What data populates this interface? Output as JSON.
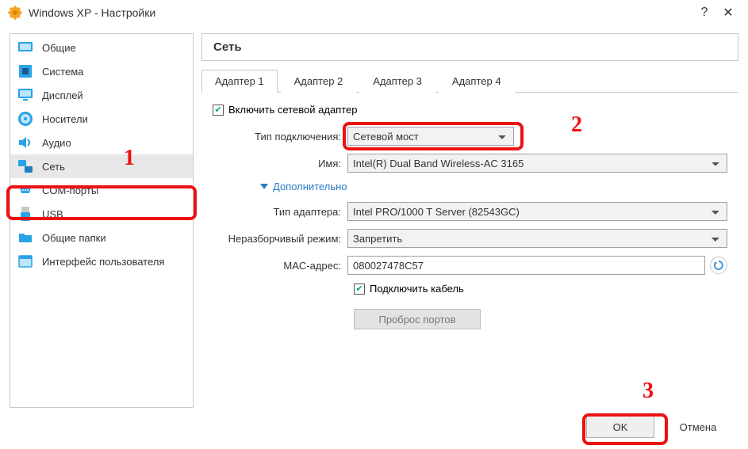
{
  "titlebar": {
    "title": "Windows XP - Настройки"
  },
  "sidebar": {
    "items": [
      {
        "label": "Общие"
      },
      {
        "label": "Система"
      },
      {
        "label": "Дисплей"
      },
      {
        "label": "Носители"
      },
      {
        "label": "Аудио"
      },
      {
        "label": "Сеть"
      },
      {
        "label": "COM-порты"
      },
      {
        "label": "USB"
      },
      {
        "label": "Общие папки"
      },
      {
        "label": "Интерфейс пользователя"
      }
    ],
    "selected_index": 5
  },
  "main": {
    "heading": "Сеть",
    "tabs": [
      {
        "label": "Адаптер 1"
      },
      {
        "label": "Адаптер 2"
      },
      {
        "label": "Адаптер 3"
      },
      {
        "label": "Адаптер 4"
      }
    ],
    "active_tab": 0,
    "enable_adapter": {
      "label": "Включить сетевой адаптер",
      "checked": true
    },
    "conn_type": {
      "label": "Тип подключения:",
      "value": "Сетевой мост"
    },
    "name": {
      "label": "Имя:",
      "value": "Intel(R) Dual Band Wireless-AC 3165"
    },
    "advanced": {
      "label": "Дополнительно"
    },
    "adapter_type": {
      "label": "Тип адаптера:",
      "value": "Intel PRO/1000 T Server (82543GC)"
    },
    "promiscuous": {
      "label": "Неразборчивый режим:",
      "value": "Запретить"
    },
    "mac": {
      "label": "MAC-адрес:",
      "value": "080027478C57"
    },
    "connect_cable": {
      "label": "Подключить кабель",
      "checked": true
    },
    "port_forward": {
      "label": "Проброс портов"
    }
  },
  "buttons": {
    "ok": "OK",
    "cancel": "Отмена"
  },
  "annotations": {
    "a1": "1",
    "a2": "2",
    "a3": "3"
  }
}
